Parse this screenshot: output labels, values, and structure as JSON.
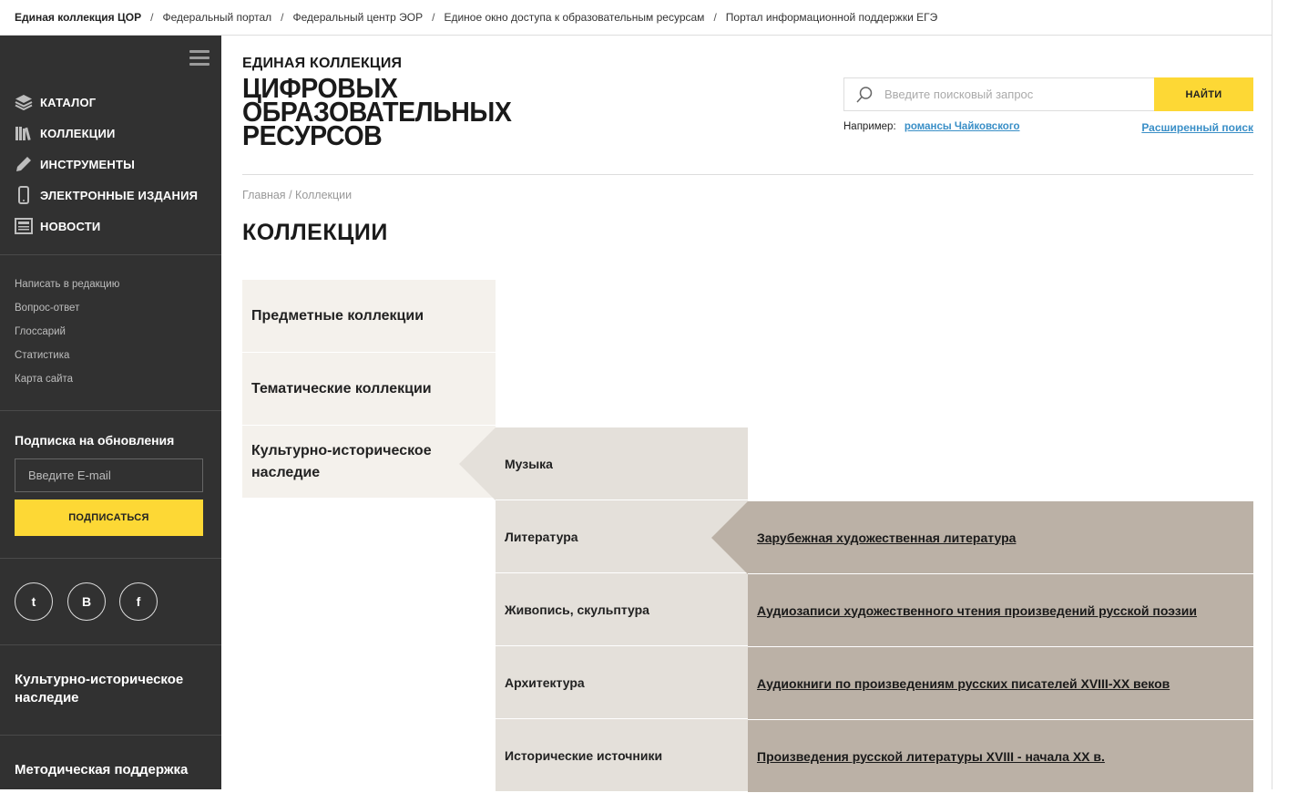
{
  "topbar": {
    "links": [
      "Единая коллекция ЦОР",
      "Федеральный портал",
      "Федеральный центр ЭОР",
      "Единое окно доступа к образовательным ресурсам",
      "Портал информационной поддержки ЕГЭ"
    ],
    "separator": "/"
  },
  "sidebar": {
    "nav": [
      {
        "label": "КАТАЛОГ",
        "icon": "layers-icon"
      },
      {
        "label": "КОЛЛЕКЦИИ",
        "icon": "books-icon"
      },
      {
        "label": "ИНСТРУМЕНТЫ",
        "icon": "pencil-icon"
      },
      {
        "label": "ЭЛЕКТРОННЫЕ ИЗДАНИЯ",
        "icon": "phone-icon"
      },
      {
        "label": "НОВОСТИ",
        "icon": "newspaper-icon"
      }
    ],
    "links": [
      "Написать в редакцию",
      "Вопрос-ответ",
      "Глоссарий",
      "Статистика",
      "Карта сайта"
    ],
    "subscribe": {
      "title": "Подписка на обновления",
      "placeholder": "Введите E-mail",
      "button": "ПОДПИСАТЬСЯ"
    },
    "social": [
      "twitter-icon",
      "vk-icon",
      "facebook-icon"
    ],
    "social_glyphs": [
      "t",
      "B",
      "f"
    ],
    "sections": [
      "Культурно-историческое наследие",
      "Методическая поддержка"
    ]
  },
  "header": {
    "logo_line1": "ЕДИНАЯ КОЛЛЕКЦИЯ",
    "logo_line2": "ЦИФРОВЫХ",
    "logo_line3": "ОБРАЗОВАТЕЛЬНЫХ",
    "logo_line4": "РЕСУРСОВ",
    "search_placeholder": "Введите поисковый запрос",
    "search_button": "НАЙТИ",
    "example_label": "Например:",
    "example_link": "романсы Чайковского",
    "advanced_search": "Расширенный поиск"
  },
  "breadcrumb": {
    "home": "Главная",
    "sep": "/",
    "current": "Коллекции"
  },
  "page_title": "КОЛЛЕКЦИИ",
  "collections": {
    "level1": [
      "Предметные коллекции",
      "Тематические коллекции",
      "Культурно-историческое наследие"
    ],
    "level2": [
      "Музыка",
      "Литература",
      "Живопись, скульптура",
      "Архитектура",
      "Исторические источники"
    ],
    "level3": [
      "Зарубежная художественная литература",
      "Аудиозаписи художественного чтения произведений русской поэзии",
      "Аудиокниги по произведениям русских писателей XVIII-XX веков",
      "Произведения русской литературы XVIII - начала XX в."
    ]
  },
  "colors": {
    "sidebar": "#313131",
    "accent": "#fdd835",
    "link": "#3a8fc7",
    "level1": "#f4f1ec",
    "level2": "#e4e0da",
    "level3": "#bbb1a6"
  }
}
